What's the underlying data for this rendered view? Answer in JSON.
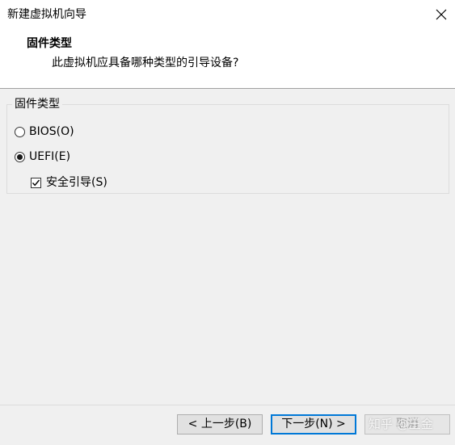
{
  "window": {
    "title": "新建虚拟机向导",
    "close_icon": "close-icon"
  },
  "header": {
    "title": "固件类型",
    "subtitle": "此虚拟机应具备哪种类型的引导设备?"
  },
  "firmware_group": {
    "legend": "固件类型",
    "options": [
      {
        "label": "BIOS(O)",
        "checked": false
      },
      {
        "label": "UEFI(E)",
        "checked": true
      }
    ],
    "secure_boot": {
      "label": "安全引导(S)",
      "checked": true
    }
  },
  "footer": {
    "back_label": "< 上一步(B)",
    "next_label": "下一步(N) >",
    "cancel_label": "取消"
  },
  "watermark": {
    "text": "知乎 @王金"
  },
  "colors": {
    "accent": "#0078d7",
    "panel_bg": "#f0f0f0",
    "button_bg": "#e1e1e1"
  }
}
